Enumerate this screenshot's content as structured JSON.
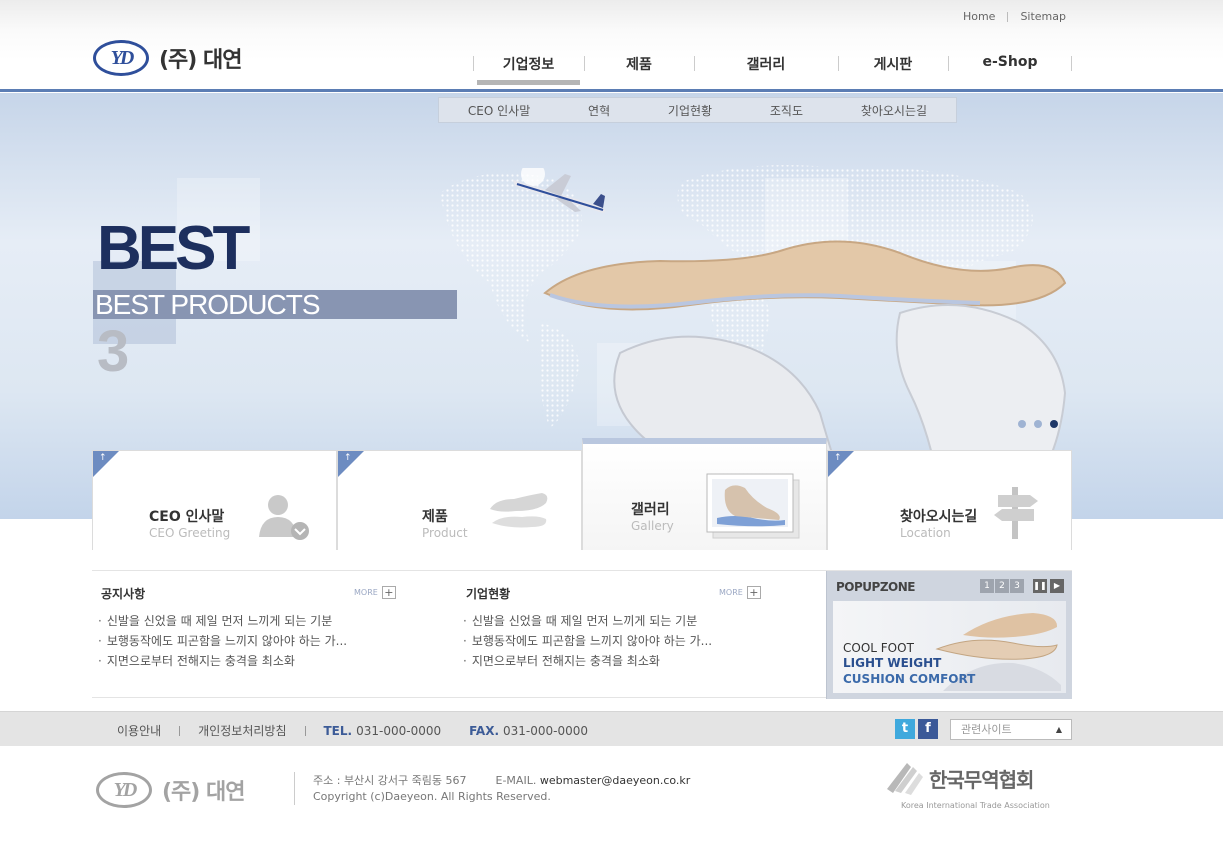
{
  "util": {
    "home": "Home",
    "sitemap": "Sitemap"
  },
  "logo": {
    "mark": "YD",
    "text": "(주) 대연"
  },
  "gnb": [
    {
      "label": "기업정보"
    },
    {
      "label": "제품"
    },
    {
      "label": "갤러리"
    },
    {
      "label": "게시판"
    },
    {
      "label": "e-Shop"
    }
  ],
  "subnav": [
    "CEO 인사말",
    "연혁",
    "기업현황",
    "조직도",
    "찾아오시는길"
  ],
  "hero": {
    "headline": "BEST",
    "subline": "BEST PRODUCTS",
    "number": "3"
  },
  "quick": [
    {
      "title": "CEO 인사말",
      "en": "CEO Greeting",
      "icon": "person-icon"
    },
    {
      "title": "제품",
      "en": "Product",
      "icon": "insole-icon"
    },
    {
      "title": "갤러리",
      "en": "Gallery",
      "icon": "foot-photo-icon"
    },
    {
      "title": "찾아오시는길",
      "en": "Location",
      "icon": "signpost-icon"
    }
  ],
  "boards": {
    "notice": {
      "title": "공지사항",
      "more": "MORE",
      "items": [
        "신발을 신었을 때 제일 먼저 느끼게 되는 기분",
        "보행동작에도 피곤함을 느끼지 않아야 하는 가...",
        "지면으로부터 전해지는 충격을 최소화"
      ]
    },
    "company": {
      "title": "기업현황",
      "more": "MORE",
      "items": [
        "신발을 신었을 때 제일 먼저 느끼게 되는 기분",
        "보행동작에도 피곤함을 느끼지 않아야 하는 가...",
        "지면으로부터 전해지는 충격을 최소화"
      ]
    }
  },
  "popup": {
    "title": "POPUPZONE",
    "pages": [
      "1",
      "2",
      "3"
    ],
    "banner": {
      "line1": "COOL FOOT",
      "line2": "LIGHT WEIGHT",
      "line3": "CUSHION COMFORT"
    }
  },
  "footer_bar": {
    "terms": "이용안내",
    "privacy": "개인정보처리방침",
    "tel_label": "TEL.",
    "tel": "031-000-0000",
    "fax_label": "FAX.",
    "fax": "031-000-0000",
    "related": "관련사이트"
  },
  "footer": {
    "address": "주소 : 부산시 강서구 죽림동 567",
    "email_label": "E-MAIL.",
    "email": "webmaster@daeyeon.co.kr",
    "copyright": "Copyright (c)Daeyeon. All Rights Reserved.",
    "kita_name": "한국무역협회",
    "kita_en": "Korea International Trade Association"
  },
  "colors": {
    "brand_blue": "#2f4f9b",
    "header_line": "#5b7db4",
    "accent": "#6d8cc1"
  }
}
